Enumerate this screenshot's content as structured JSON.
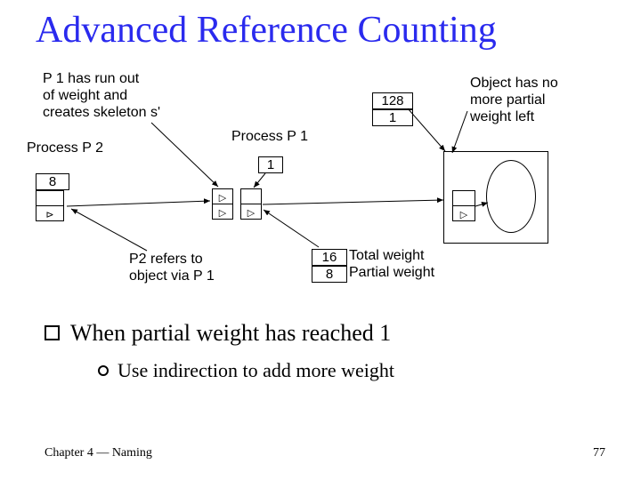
{
  "title": "Advanced Reference Counting",
  "annotations": {
    "p1_runout": "P 1 has run out\nof weight and\ncreates skeleton s'",
    "obj_none": "Object has no\nmore partial\nweight left",
    "p2_refers": "P2 refers to\nobject via P 1",
    "total_w": "Total weight",
    "partial_w": "Partial weight"
  },
  "labels": {
    "p1": "Process P 1",
    "p2": "Process P 2"
  },
  "values": {
    "eight": "8",
    "one": "1",
    "v128": "128",
    "v1": "1",
    "v16": "16",
    "v8": "8"
  },
  "bullet": "When partial weight has reached 1",
  "subbullet": "Use indirection to add more weight",
  "footer": "Chapter 4 — Naming",
  "page": "77"
}
